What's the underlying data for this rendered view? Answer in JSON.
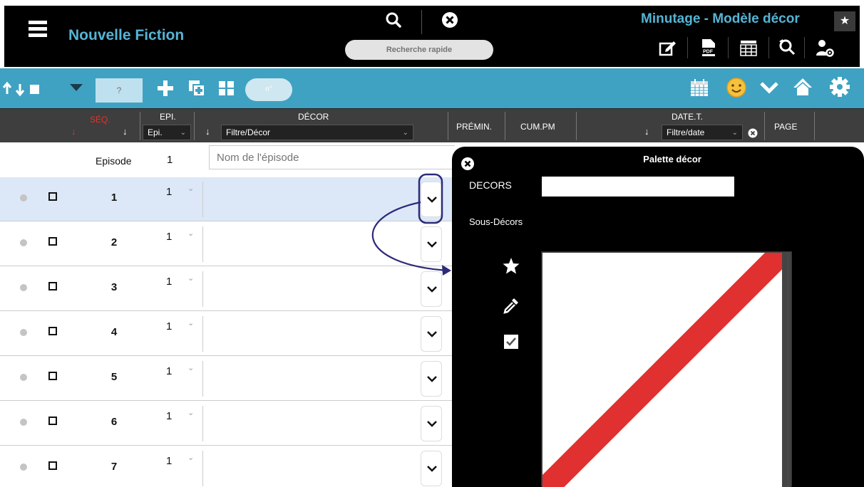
{
  "header": {
    "app_title": "Nouvelle Fiction",
    "quick_search_placeholder": "Recherche rapide",
    "module_title": "Minutage - Modèle décor",
    "star_glyph": "★"
  },
  "toolbar": {
    "seq_input_value": "?",
    "num_pill": "n°",
    "accent_color": "#3fa2c2"
  },
  "columns": {
    "seq": "SÉQ.",
    "epi": "EPI.",
    "epi_select": "Epi.",
    "decor": "DÉCOR",
    "decor_filter": "Filtre/Décor",
    "premin": "PRÉMIN.",
    "cum_pm": "CUM.PM",
    "date_t": "DATE.T.",
    "date_filter": "Filtre/date",
    "page": "PAGE"
  },
  "episode_row": {
    "label": "Episode",
    "number": "1",
    "name_placeholder": "Nom de l'épisode"
  },
  "rows": [
    {
      "seq": "1",
      "epi": "1"
    },
    {
      "seq": "2",
      "epi": "1"
    },
    {
      "seq": "3",
      "epi": "1"
    },
    {
      "seq": "4",
      "epi": "1"
    },
    {
      "seq": "5",
      "epi": "1"
    },
    {
      "seq": "6",
      "epi": "1"
    },
    {
      "seq": "7",
      "epi": "1"
    }
  ],
  "palette": {
    "title": "Palette décor",
    "decors_label": "DECORS",
    "decors_value": "",
    "sous_decors_label": "Sous-Décors",
    "swatch_rows": [
      [
        "none",
        "#ffffff",
        "#e6e6e6",
        "#cccccc",
        "#b3b3b3",
        "#999999",
        "#808080",
        "#666666",
        "#4d4d4d",
        "#333333",
        "#1a1a1a",
        "#000000"
      ],
      [
        "#0a2a3a",
        "#0a1a44",
        "#1a0a3c",
        "#2a0a36",
        "#360a22",
        "#440a0a",
        "#3e1a08",
        "#3c2a06",
        "#3a3606",
        "#2e3a06",
        "#223a08",
        "#16300e"
      ],
      [
        "#103e58",
        "#102a68",
        "#26105c",
        "#401054",
        "#521034",
        "#661010",
        "#5c280c",
        "#5a400a",
        "#56520a",
        "#465608",
        "#34560c",
        "#224816"
      ],
      [
        "#17628c",
        "#1742a8",
        "#3a1890",
        "#601884",
        "#7e1852",
        "#a01818",
        "#923e12",
        "#8c6410",
        "#888210",
        "#6e880e",
        "#528812",
        "#367224"
      ],
      [
        "#1f7fbf",
        "#1f55d8",
        "#4a20c0",
        "#8020ae",
        "#a8206c",
        "#d62020",
        "#c45418",
        "#bc8818",
        "#b8b018",
        "#94b816",
        "#6eb81c",
        "#48982e"
      ],
      [
        "#2798e0",
        "#2a66f0",
        "#5a28d8",
        "#9c28cc",
        "#cc2878",
        "#f22828",
        "#ec6a20",
        "#e8aa20",
        "#e6dc20",
        "#b4e21e",
        "#82e224",
        "#58bc3c"
      ],
      [
        "#34b0f0",
        "#3a7cf8",
        "#6a3cf0",
        "#b03ce4",
        "#e23c8c",
        "#f84848",
        "#f88438",
        "#f8c034",
        "#f6ee34",
        "#c8f034",
        "#98ee3c",
        "#6ccc50"
      ],
      [
        "#62c4f4",
        "#6696f8",
        "#8460f4",
        "#c060ec",
        "#ec60a8",
        "#f87070",
        "#f89e5c",
        "#f8cc58",
        "#f8f058",
        "#d4f458",
        "#aef064",
        "#88d870"
      ],
      [
        "#90d4f6",
        "#90b0f8",
        "#a48cf6",
        "#d08cf0",
        "#f08cc0",
        "#f8989a",
        "#f8b888",
        "#f8d886",
        "#f8f486",
        "#e0f686",
        "#c4f490",
        "#a8e296"
      ],
      [
        "#c0e6f8",
        "#c0d0fa",
        "#c8b8f8",
        "#e4b8f4",
        "#f6b8d8",
        "#fac4c4",
        "#fad4b8",
        "#fae8b8",
        "#faf8b8",
        "#ecf8b8",
        "#dcf8c0",
        "#cceec4"
      ]
    ]
  }
}
